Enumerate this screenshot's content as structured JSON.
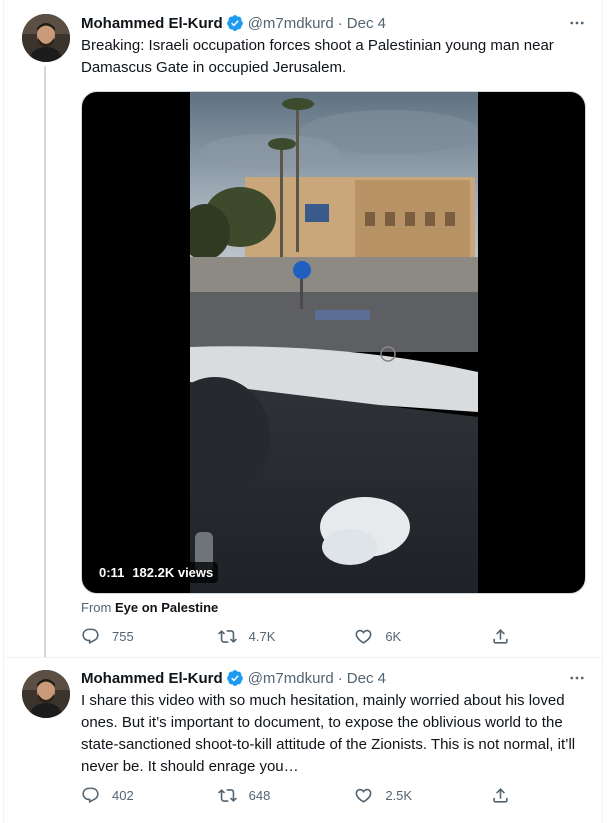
{
  "tweets": [
    {
      "author": {
        "name": "Mohammed El-Kurd",
        "handle": "@m7mdkurd",
        "date": "Dec 4",
        "verified": true
      },
      "text": "Breaking: Israeli occupation forces shoot a Palestinian young man near Damascus Gate in occupied Jerusalem.",
      "media": {
        "duration": "0:11",
        "views": "182.2K views"
      },
      "source": {
        "prefix": "From",
        "name": "Eye on Palestine"
      },
      "stats": {
        "replies": "755",
        "retweets": "4.7K",
        "likes": "6K"
      }
    },
    {
      "author": {
        "name": "Mohammed El-Kurd",
        "handle": "@m7mdkurd",
        "date": "Dec 4",
        "verified": true
      },
      "text": "I share this video with so much hesitation, mainly worried about his loved ones. But it’s important to document, to expose the oblivious world to the state-sanctioned shoot-to-kill attitude of the Zionists. This is not normal, it’ll never be. It should enrage you…",
      "stats": {
        "replies": "402",
        "retweets": "648",
        "likes": "2.5K"
      }
    }
  ],
  "colors": {
    "text_primary": "#0f1419",
    "text_secondary": "#536471",
    "verified_blue": "#1d9bf0",
    "divider": "#eff3f4",
    "thread_line": "#cfd9de"
  },
  "icons": {
    "verified": "verified-badge-icon",
    "more": "more-dots-icon",
    "reply": "reply-icon",
    "retweet": "retweet-icon",
    "like": "heart-icon",
    "share": "share-icon"
  }
}
